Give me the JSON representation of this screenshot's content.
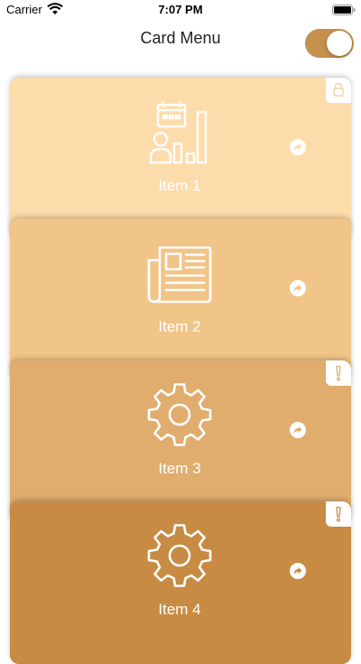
{
  "status_bar": {
    "carrier": "Carrier",
    "time": "7:07 PM"
  },
  "nav": {
    "title": "Card Menu",
    "toggle_on": true,
    "toggle_color": "#c58f4c"
  },
  "cards": [
    {
      "label": "Item 1",
      "icon": "chart-person-icon",
      "color": "#fddcab",
      "corner_icon": "lock-icon"
    },
    {
      "label": "Item 2",
      "icon": "newspaper-icon",
      "color": "#f1c487",
      "corner_icon": ""
    },
    {
      "label": "Item 3",
      "icon": "gear-icon",
      "color": "#e0ad6f",
      "corner_icon": "exclamation-icon"
    },
    {
      "label": "Item 4",
      "icon": "gear-icon",
      "color": "#c78b44",
      "corner_icon": "exclamation-icon"
    }
  ]
}
